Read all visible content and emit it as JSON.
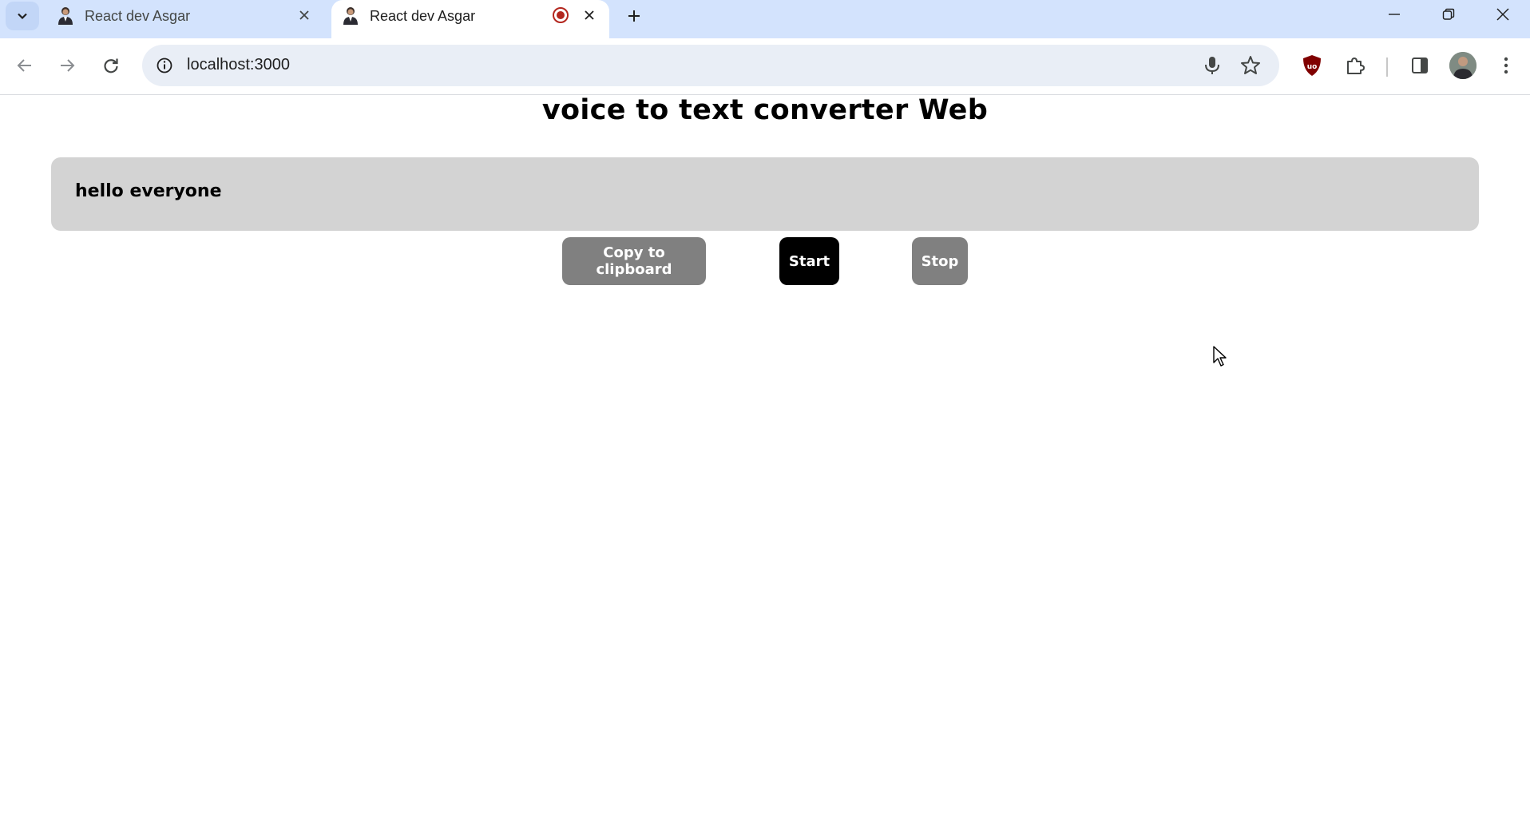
{
  "browser": {
    "tabs": [
      {
        "title": "React dev Asgar",
        "active": false,
        "favicon": "person-avatar-icon"
      },
      {
        "title": "React dev Asgar",
        "active": true,
        "favicon": "person-avatar-icon",
        "recording": true
      }
    ],
    "url": "localhost:3000",
    "accent_color": "#d3e3fd"
  },
  "page": {
    "title": "voice to text converter Web",
    "transcript": "hello everyone",
    "buttons": {
      "copy": "Copy to clipboard",
      "start": "Start",
      "stop": "Stop"
    },
    "colors": {
      "transcript_bg": "#d3d3d3",
      "button_gray": "#808080",
      "button_active": "#000000"
    }
  }
}
